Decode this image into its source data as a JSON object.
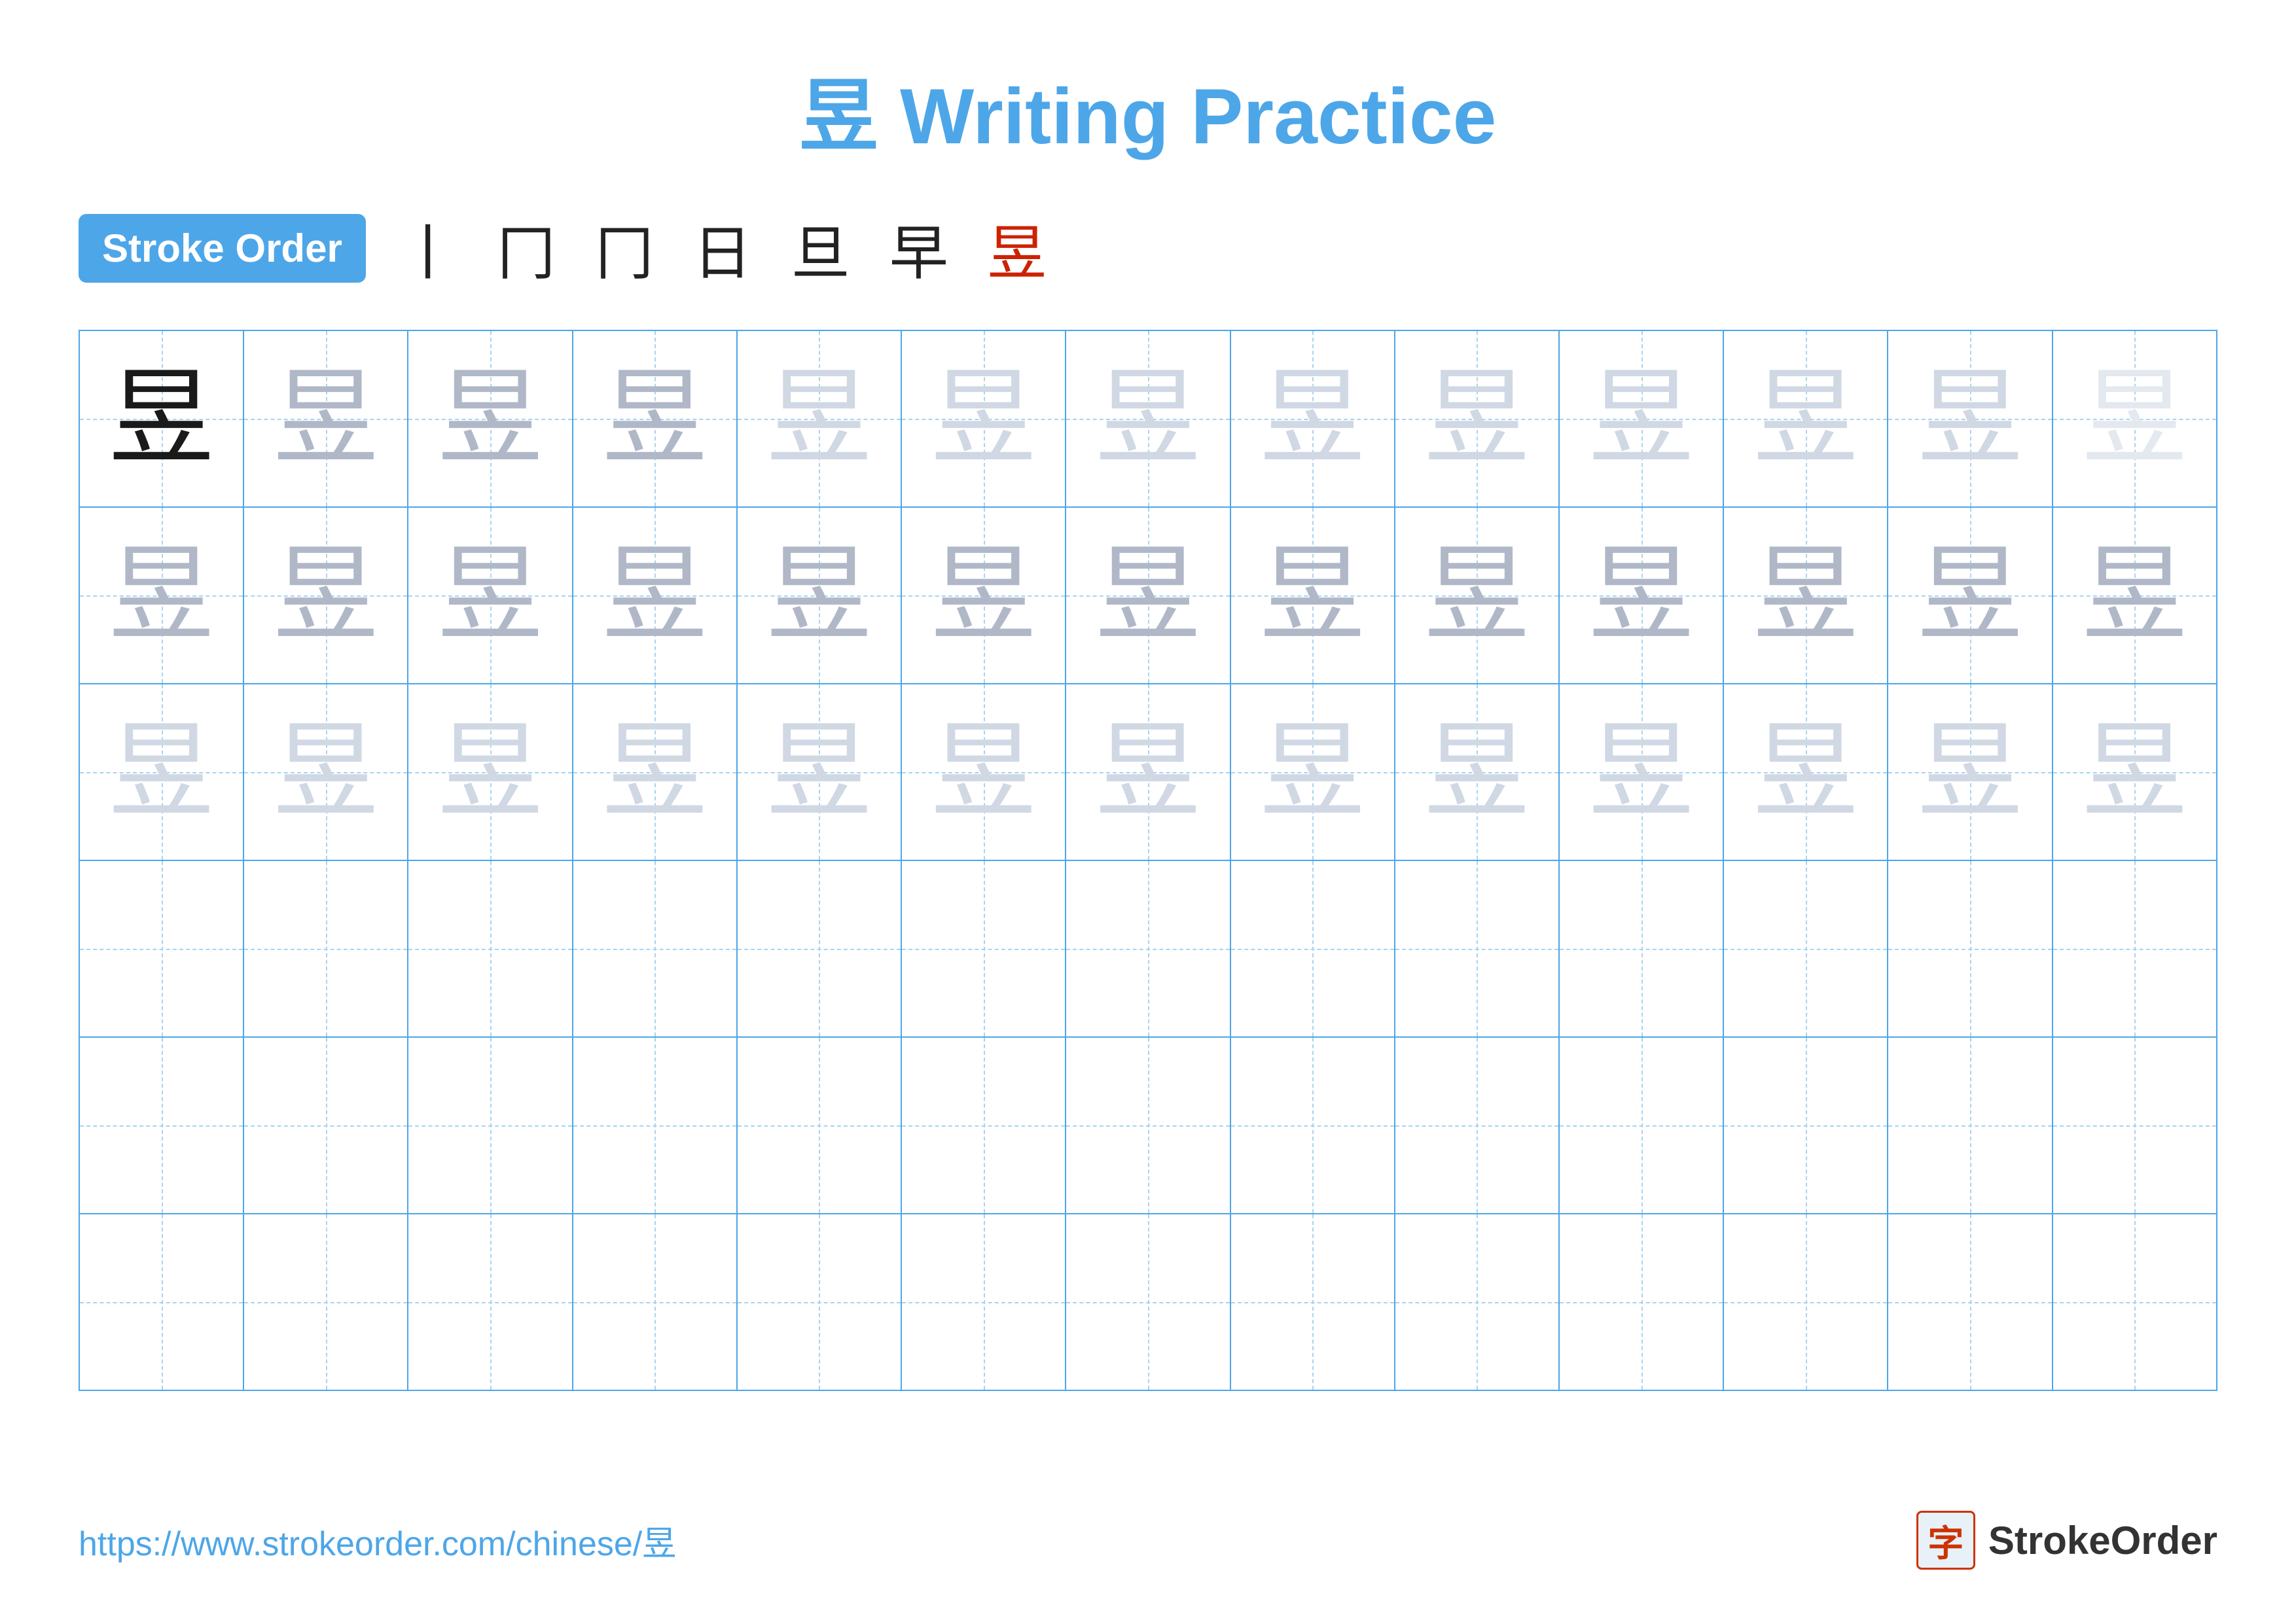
{
  "title": {
    "char": "昱",
    "text": "Writing Practice",
    "full": "昱 Writing Practice"
  },
  "stroke_order": {
    "badge_label": "Stroke Order",
    "steps": [
      "丨",
      "冂",
      "冂",
      "日",
      "旦",
      "早",
      "昱"
    ]
  },
  "grid": {
    "rows": 6,
    "cols": 13,
    "char": "昱",
    "row_types": [
      "dark-fade",
      "medium",
      "light",
      "empty",
      "empty",
      "empty"
    ]
  },
  "footer": {
    "url": "https://www.strokeorder.com/chinese/昱",
    "logo_char": "字",
    "logo_text": "StrokeOrder"
  }
}
